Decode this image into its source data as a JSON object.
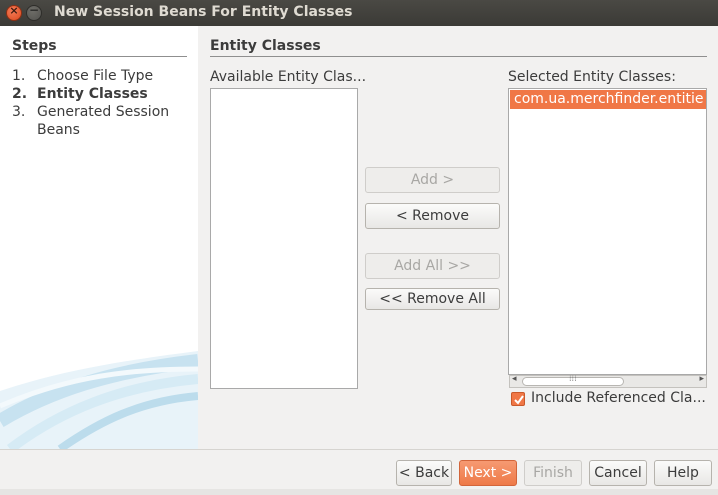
{
  "window": {
    "title": "New Session Beans For Entity Classes",
    "close_glyph": "×",
    "minimize_glyph": "−"
  },
  "steps": {
    "heading": "Steps",
    "items": [
      {
        "num": "1.",
        "label": "Choose File Type"
      },
      {
        "num": "2.",
        "label": "Entity Classes"
      },
      {
        "num": "3.",
        "label": "Generated Session Beans"
      }
    ]
  },
  "panel": {
    "heading": "Entity Classes",
    "available_label": "Available Entity Clas...",
    "selected_label": "Selected Entity Classes:",
    "available_items": [],
    "selected_items": [
      "com.ua.merchfinder.entitie"
    ],
    "include_label": "Include Referenced Cla...",
    "include_checked": true,
    "scroll_grip": "⁞⁞⁞"
  },
  "buttons": {
    "add": "Add >",
    "remove": "< Remove",
    "add_all": "Add All >>",
    "remove_all": "<< Remove All"
  },
  "footer": {
    "back": "< Back",
    "next": "Next >",
    "finish": "Finish",
    "cancel": "Cancel",
    "help": "Help"
  },
  "colors": {
    "accent": "#f07746",
    "titlebar": "#3b3a36"
  }
}
